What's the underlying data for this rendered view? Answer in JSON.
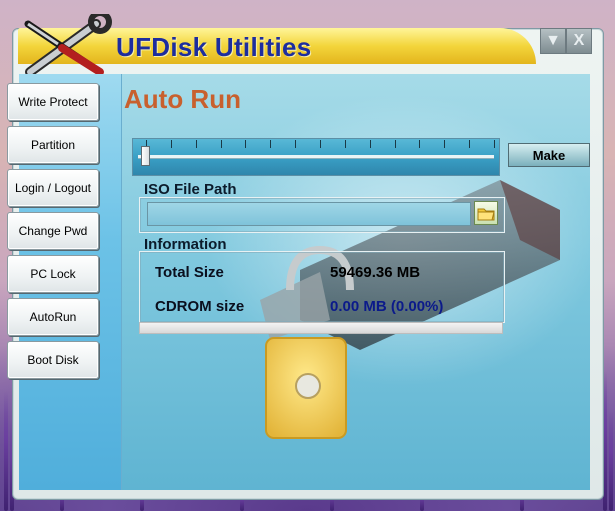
{
  "window": {
    "title": "UFDisk Utilities"
  },
  "window_controls": [
    {
      "name": "minimize",
      "glyph": "▼"
    },
    {
      "name": "close",
      "glyph": "X"
    }
  ],
  "sidebar": {
    "items": [
      {
        "label": "Write Protect"
      },
      {
        "label": "Partition"
      },
      {
        "label": "Login / Logout"
      },
      {
        "label": "Change Pwd"
      },
      {
        "label": "PC Lock"
      },
      {
        "label": "AutoRun"
      },
      {
        "label": "Boot Disk"
      }
    ]
  },
  "main": {
    "title": "Auto Run",
    "slider": {
      "ticks": 15,
      "value": 0
    },
    "make_label": "Make",
    "iso": {
      "label": "ISO File Path",
      "value": ""
    },
    "info": {
      "label": "Information",
      "total_size_label": "Total Size",
      "total_size_value": "59469.36 MB",
      "cdrom_label": "CDROM size",
      "cdrom_value": "0.00 MB (0.00%)"
    },
    "progress_fraction": 0.0
  },
  "colors": {
    "title_text": "#1d2d9e",
    "page_title": "#c8602e",
    "cdrom_value": "#0b1a8a",
    "total_value": "#000000"
  },
  "icons": {
    "logo": "tools-logo-icon",
    "folder": "folder-browse-icon",
    "usb": "usb-drive-lock-icon"
  }
}
